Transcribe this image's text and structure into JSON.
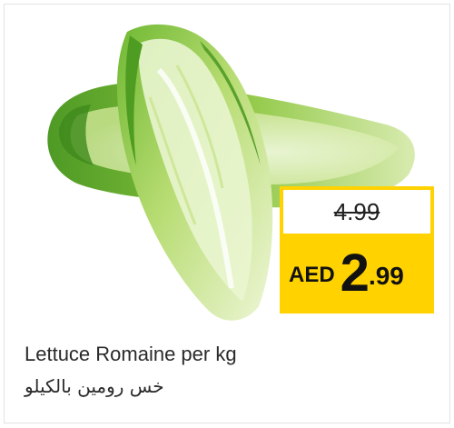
{
  "product": {
    "name_en": "Lettuce Romaine per kg",
    "name_ar": "خس رومين بالكيلو",
    "image_icon": "romaine-lettuce-illustration"
  },
  "pricing": {
    "old_price": "4.99",
    "currency": "AED",
    "new_price_integer": "2",
    "new_price_fraction": ".99"
  },
  "colors": {
    "price_yellow": "#ffd200",
    "text_dark": "#111111",
    "lettuce_light": "#e6f3c2",
    "lettuce_dark": "#5aa12c"
  }
}
